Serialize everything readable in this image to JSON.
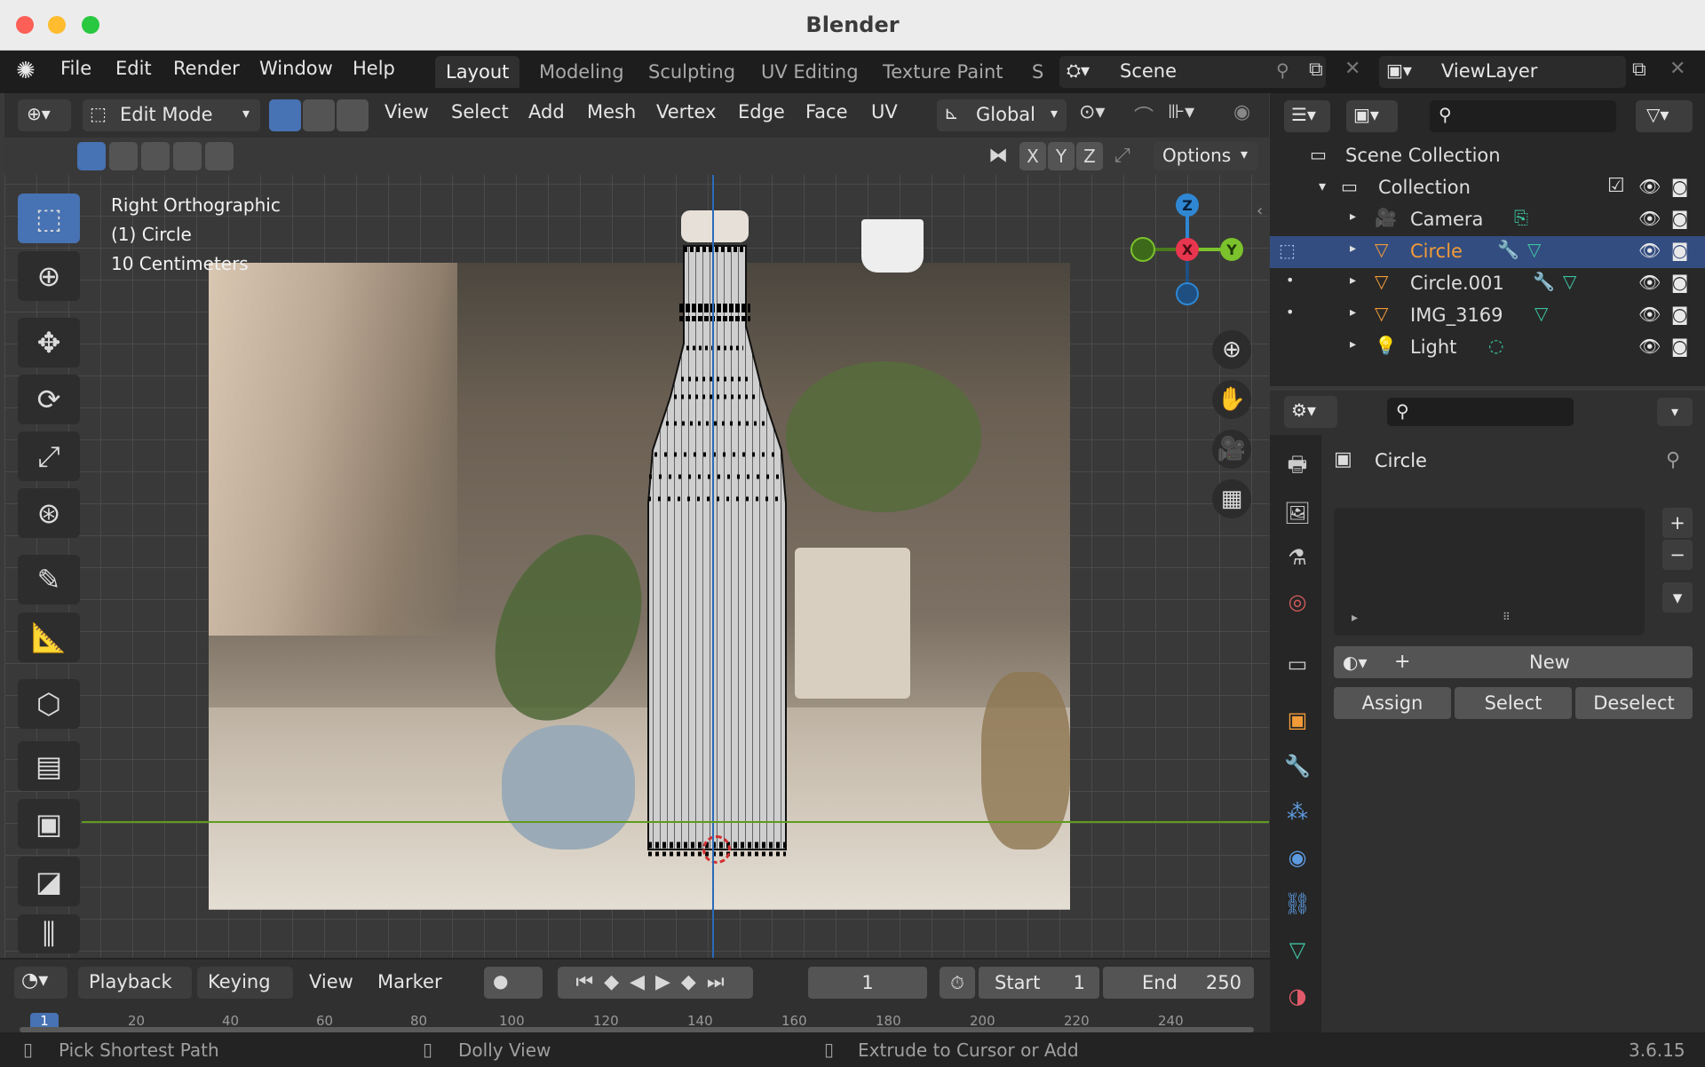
{
  "window": {
    "title": "Blender"
  },
  "menu": [
    "File",
    "Edit",
    "Render",
    "Window",
    "Help"
  ],
  "workspaces": [
    "Layout",
    "Modeling",
    "Sculpting",
    "UV Editing",
    "Texture Paint",
    "S"
  ],
  "scene": {
    "name": "Scene"
  },
  "view_layer": {
    "name": "ViewLayer"
  },
  "viewport_header": {
    "mode": "Edit Mode",
    "menus": [
      "View",
      "Select",
      "Add",
      "Mesh",
      "Vertex",
      "Edge",
      "Face",
      "UV"
    ],
    "transform_orientation": "Global",
    "axes": [
      "X",
      "Y",
      "Z"
    ],
    "options": "Options"
  },
  "viewport_overlay": {
    "view_name": "Right Orthographic",
    "object": "(1) Circle",
    "scale": "10 Centimeters"
  },
  "gizmo": {
    "z": "Z",
    "x": "X",
    "y": "Y"
  },
  "timeline": {
    "menus": [
      "Playback",
      "Keying",
      "View",
      "Marker"
    ],
    "current_frame": "1",
    "start_label": "Start",
    "start_value": "1",
    "end_label": "End",
    "end_value": "250",
    "ruler": [
      "1",
      "20",
      "40",
      "60",
      "80",
      "100",
      "120",
      "140",
      "160",
      "180",
      "200",
      "220",
      "240"
    ]
  },
  "outliner": {
    "root": "Scene Collection",
    "collection": "Collection",
    "items": [
      {
        "name": "Camera",
        "selected": false
      },
      {
        "name": "Circle",
        "selected": true
      },
      {
        "name": "Circle.001",
        "selected": false
      },
      {
        "name": "IMG_3169",
        "selected": false
      },
      {
        "name": "Light",
        "selected": false
      }
    ]
  },
  "properties": {
    "object_name": "Circle",
    "new_label": "New",
    "assign": "Assign",
    "select": "Select",
    "deselect": "Deselect"
  },
  "status": {
    "left": "Pick Shortest Path",
    "middle": "Dolly View",
    "right": "Extrude to Cursor or Add",
    "version": "3.6.15"
  },
  "colors": {
    "accent_blue": "#4772b3",
    "selected_row": "#334d80",
    "axis_x": "#e8364f",
    "axis_y": "#7bc22c",
    "axis_z": "#2f87d3",
    "object_orange": "#f29b38"
  }
}
